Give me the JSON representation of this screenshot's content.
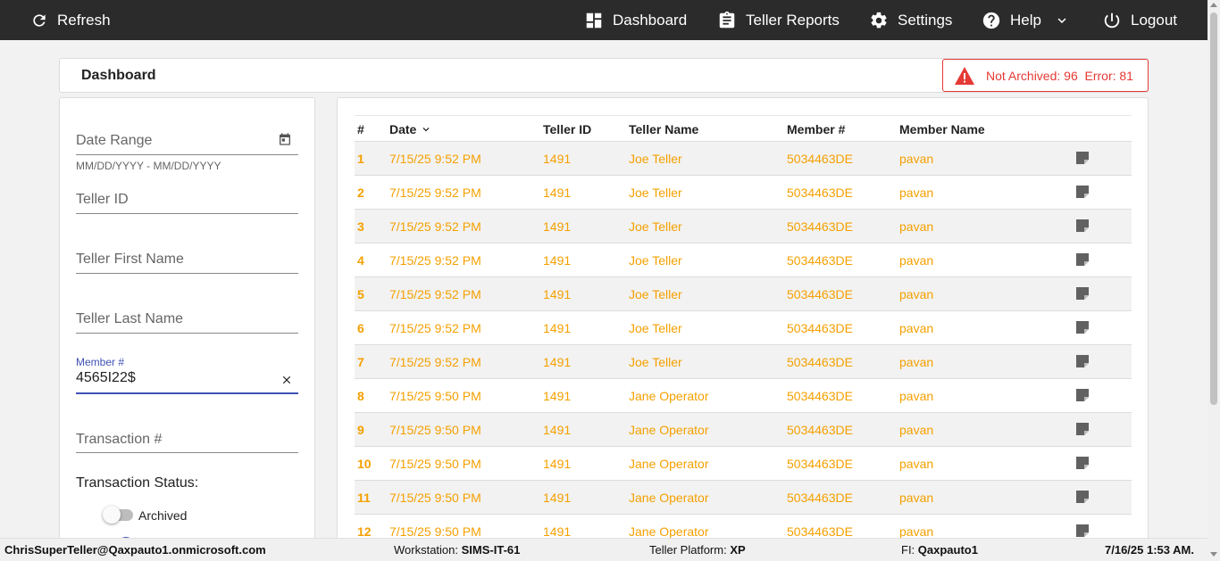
{
  "topbar": {
    "refresh": "Refresh",
    "dashboard": "Dashboard",
    "teller_reports": "Teller Reports",
    "settings": "Settings",
    "help": "Help",
    "logout": "Logout"
  },
  "header": {
    "title": "Dashboard",
    "status": "Not Archived: 96  Error: 81"
  },
  "filters": {
    "date_range_label": "Date Range",
    "date_range_hint": "MM/DD/YYYY - MM/DD/YYYY",
    "teller_id_label": "Teller ID",
    "teller_first_label": "Teller First Name",
    "teller_last_label": "Teller Last Name",
    "member_label": "Member #",
    "member_value": "4565I22$",
    "transaction_label": "Transaction #",
    "status_heading": "Transaction Status:",
    "archived_label": "Archived",
    "archived_on": false
  },
  "table": {
    "headers": [
      "#",
      "Date",
      "Teller ID",
      "Teller Name",
      "Member #",
      "Member Name"
    ],
    "rows": [
      [
        "1",
        "7/15/25 9:52 PM",
        "1491",
        "Joe Teller",
        "5034463DE",
        "pavan"
      ],
      [
        "2",
        "7/15/25 9:52 PM",
        "1491",
        "Joe Teller",
        "5034463DE",
        "pavan"
      ],
      [
        "3",
        "7/15/25 9:52 PM",
        "1491",
        "Joe Teller",
        "5034463DE",
        "pavan"
      ],
      [
        "4",
        "7/15/25 9:52 PM",
        "1491",
        "Joe Teller",
        "5034463DE",
        "pavan"
      ],
      [
        "5",
        "7/15/25 9:52 PM",
        "1491",
        "Joe Teller",
        "5034463DE",
        "pavan"
      ],
      [
        "6",
        "7/15/25 9:52 PM",
        "1491",
        "Joe Teller",
        "5034463DE",
        "pavan"
      ],
      [
        "7",
        "7/15/25 9:52 PM",
        "1491",
        "Joe Teller",
        "5034463DE",
        "pavan"
      ],
      [
        "8",
        "7/15/25 9:50 PM",
        "1491",
        "Jane Operator",
        "5034463DE",
        "pavan"
      ],
      [
        "9",
        "7/15/25 9:50 PM",
        "1491",
        "Jane Operator",
        "5034463DE",
        "pavan"
      ],
      [
        "10",
        "7/15/25 9:50 PM",
        "1491",
        "Jane Operator",
        "5034463DE",
        "pavan"
      ],
      [
        "11",
        "7/15/25 9:50 PM",
        "1491",
        "Jane Operator",
        "5034463DE",
        "pavan"
      ],
      [
        "12",
        "7/15/25 9:50 PM",
        "1491",
        "Jane Operator",
        "5034463DE",
        "pavan"
      ]
    ]
  },
  "footer": {
    "user": "ChrisSuperTeller@Qaxpauto1.onmicrosoft.com",
    "workstation_label": "Workstation:",
    "workstation": "SIMS-IT-61",
    "platform_label": "Teller Platform:",
    "platform": "XP",
    "fi_label": "FI:",
    "fi": "Qaxpauto1",
    "datetime": "7/16/25 1:53 AM."
  },
  "colors": {
    "topbar_bg": "#2b2b2b",
    "row_text": "#f5a000",
    "error": "#e53935",
    "focus": "#3f51b5"
  },
  "icons": [
    "refresh-icon",
    "dashboard-icon",
    "clipboard-icon",
    "gear-icon",
    "help-icon",
    "chevron-down-icon",
    "power-icon",
    "warning-icon",
    "calendar-icon",
    "clear-icon",
    "sort-down-icon",
    "note-icon"
  ]
}
